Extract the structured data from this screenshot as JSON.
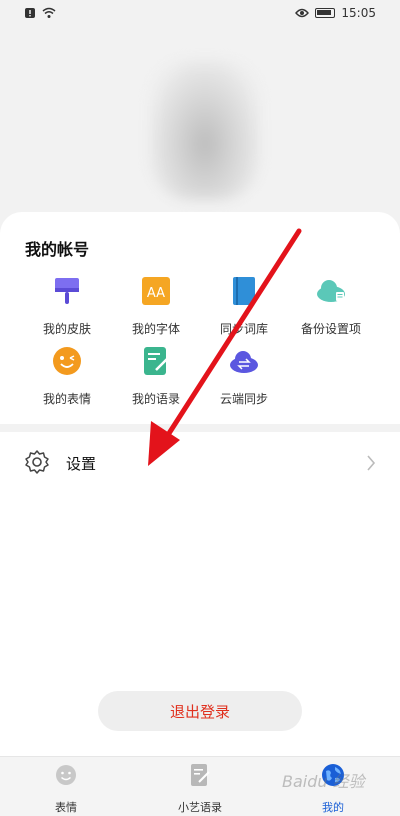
{
  "status_bar": {
    "time": "15:05"
  },
  "account": {
    "title": "我的帐号",
    "items": [
      {
        "label": "我的皮肤",
        "icon": "brush-icon"
      },
      {
        "label": "我的字体",
        "icon": "font-icon"
      },
      {
        "label": "同步词库",
        "icon": "book-icon"
      },
      {
        "label": "备份设置项",
        "icon": "cloud-backup-icon"
      },
      {
        "label": "我的表情",
        "icon": "emoji-icon"
      },
      {
        "label": "我的语录",
        "icon": "note-icon"
      },
      {
        "label": "云端同步",
        "icon": "cloud-sync-icon"
      }
    ]
  },
  "settings": {
    "label": "设置"
  },
  "logout": {
    "label": "退出登录"
  },
  "tabbar": {
    "tabs": [
      {
        "label": "表情",
        "icon": "smiley-icon"
      },
      {
        "label": "小艺语录",
        "icon": "quote-icon"
      },
      {
        "label": "我的",
        "icon": "globe-icon"
      }
    ]
  },
  "watermark": "Baidu 经验",
  "colors": {
    "accent": "#1a5fd6",
    "logout_text": "#e0301e",
    "arrow": "#e3131b"
  }
}
